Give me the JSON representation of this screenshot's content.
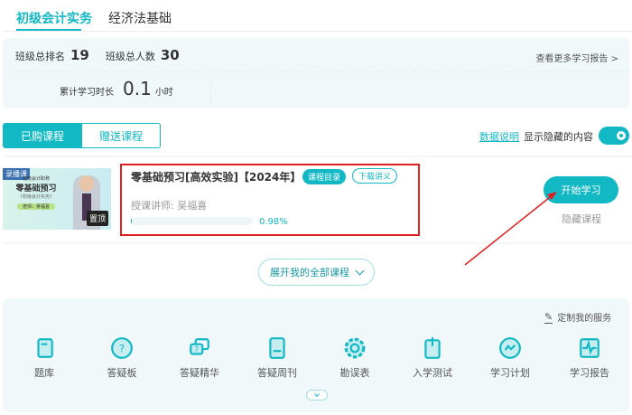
{
  "tabs": [
    {
      "label": "初级会计实务",
      "active": true
    },
    {
      "label": "经济法基础",
      "active": false
    }
  ],
  "stats": {
    "rank_label": "班级总排名",
    "rank": "19",
    "total_label": "班级总人数",
    "total": "30",
    "report_link": "查看更多学习报告 >",
    "time_label": "累计学习时长",
    "time": "0.1",
    "time_unit": "小时"
  },
  "segments": {
    "purchased": "已购课程",
    "gift": "赠送课程"
  },
  "toolbar": {
    "data_note": "数据说明",
    "show_hidden": "显示隐藏的内容",
    "toggle_on": true
  },
  "course": {
    "thumb": {
      "badge": "录播课",
      "subtitle": "初级会计职称",
      "title": "零基础预习",
      "book": "《初级会计实务》",
      "teacher": "老师：吴福喜",
      "pin": "置顶"
    },
    "title": "零基础预习[高效实验]【2024年】",
    "catalog": "课程目录",
    "download": "下载讲义",
    "teacher_label": "授课讲师:",
    "teacher": "吴福喜",
    "progress": 0.98,
    "progress_text": "0.98%",
    "start": "开始学习",
    "hide": "隐藏课程"
  },
  "expand": "展开我的全部课程",
  "services": {
    "customize": "定制我的服务",
    "items": [
      {
        "label": "题库",
        "icon": "scroll-icon"
      },
      {
        "label": "答疑板",
        "icon": "question-bubble-icon"
      },
      {
        "label": "答疑精华",
        "icon": "chat-question-icon"
      },
      {
        "label": "答疑周刊",
        "icon": "book-icon"
      },
      {
        "label": "勘误表",
        "icon": "gear-icon"
      },
      {
        "label": "入学测试",
        "icon": "test-doc-icon"
      },
      {
        "label": "学习计划",
        "icon": "plan-circle-icon"
      },
      {
        "label": "学习报告",
        "icon": "report-chart-icon"
      }
    ]
  },
  "colors": {
    "accent": "#12b8c4",
    "highlight": "#e02020"
  }
}
